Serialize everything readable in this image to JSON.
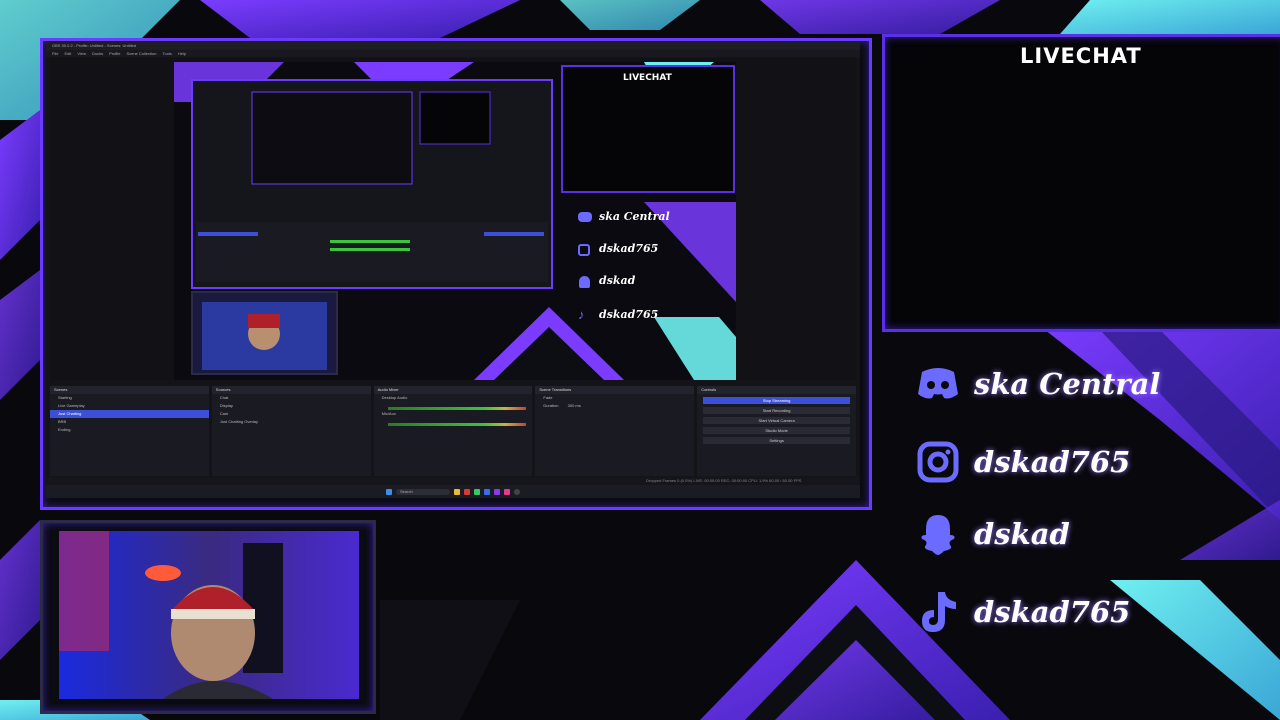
{
  "overlay": {
    "livechat_title": "LIVECHAT",
    "socials": [
      {
        "platform": "discord",
        "icon": "discord-icon",
        "label": "ska Central"
      },
      {
        "platform": "instagram",
        "icon": "instagram-icon",
        "label": "dskad765"
      },
      {
        "platform": "snapchat",
        "icon": "snapchat-icon",
        "label": "dskad"
      },
      {
        "platform": "tiktok",
        "icon": "tiktok-icon",
        "label": "dskad765"
      }
    ],
    "colors": {
      "accent_purple": "#6b3cff",
      "accent_cyan": "#4fd6e0",
      "accent_blue": "#3b4fd8"
    }
  },
  "obs": {
    "window_title": "OBS 30.0.2 - Profile: Untitled - Scenes: Untitled",
    "menu": [
      "File",
      "Edit",
      "View",
      "Docks",
      "Profile",
      "Scene Collection",
      "Tools",
      "Help"
    ],
    "preview": {
      "livechat_title": "LIVECHAT",
      "socials": [
        "ska Central",
        "dskad765",
        "dskad",
        "dskad765"
      ]
    },
    "docks": {
      "scenes": {
        "title": "Scenes",
        "items": [
          "Starting",
          "Live Gameplay",
          "Just Chatting",
          "BRB",
          "Ending"
        ],
        "selected": 2
      },
      "sources": {
        "title": "Sources",
        "items": [
          "Chat",
          "Display",
          "Cam",
          "Just Chatting Overlay"
        ]
      },
      "audio": {
        "title": "Audio Mixer",
        "channels": [
          "Desktop Audio",
          "Mic/Aux"
        ]
      },
      "transitions": {
        "title": "Scene Transitions",
        "type": "Fade",
        "duration_label": "Duration",
        "duration": "300 ms"
      },
      "controls": {
        "title": "Controls",
        "buttons": [
          "Stop Streaming",
          "Start Recording",
          "Start Virtual Camera",
          "Studio Mode",
          "Settings"
        ]
      }
    },
    "status_bar": "Dropped Frames 0 (0.0%)   LIVE: 00:00:00   REC: 00:00:00   CPU: 1.9%   60.00 / 60.00 FPS",
    "taskbar": {
      "search_placeholder": "Search"
    }
  }
}
